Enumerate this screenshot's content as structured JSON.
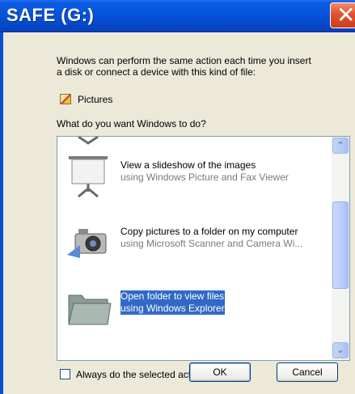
{
  "window": {
    "title": "SAFE (G:)",
    "close_glyph": "✕"
  },
  "intro_text": "Windows can perform the same action each time you insert\na disk or connect a device with this kind of file:",
  "content_type": {
    "icon": "pictures-icon",
    "label": "Pictures"
  },
  "question": "What do you want Windows to do?",
  "actions": [
    {
      "title": "View a slideshow of the images",
      "subtitle": "using Windows Picture and Fax Viewer",
      "icon": "projector-screen-icon",
      "selected": false
    },
    {
      "title": "Copy pictures to a folder on my computer",
      "subtitle": "using Microsoft Scanner and Camera Wi...",
      "icon": "camera-icon",
      "selected": false
    },
    {
      "title": "Open folder to view files",
      "subtitle": "using Windows Explorer",
      "icon": "folder-icon",
      "selected": true
    }
  ],
  "scrollbar": {
    "up_glyph": "⌃",
    "down_glyph": "⌄"
  },
  "always_checkbox": {
    "label": "Always do the selected action.",
    "checked": false
  },
  "buttons": {
    "ok": "OK",
    "cancel": "Cancel"
  }
}
